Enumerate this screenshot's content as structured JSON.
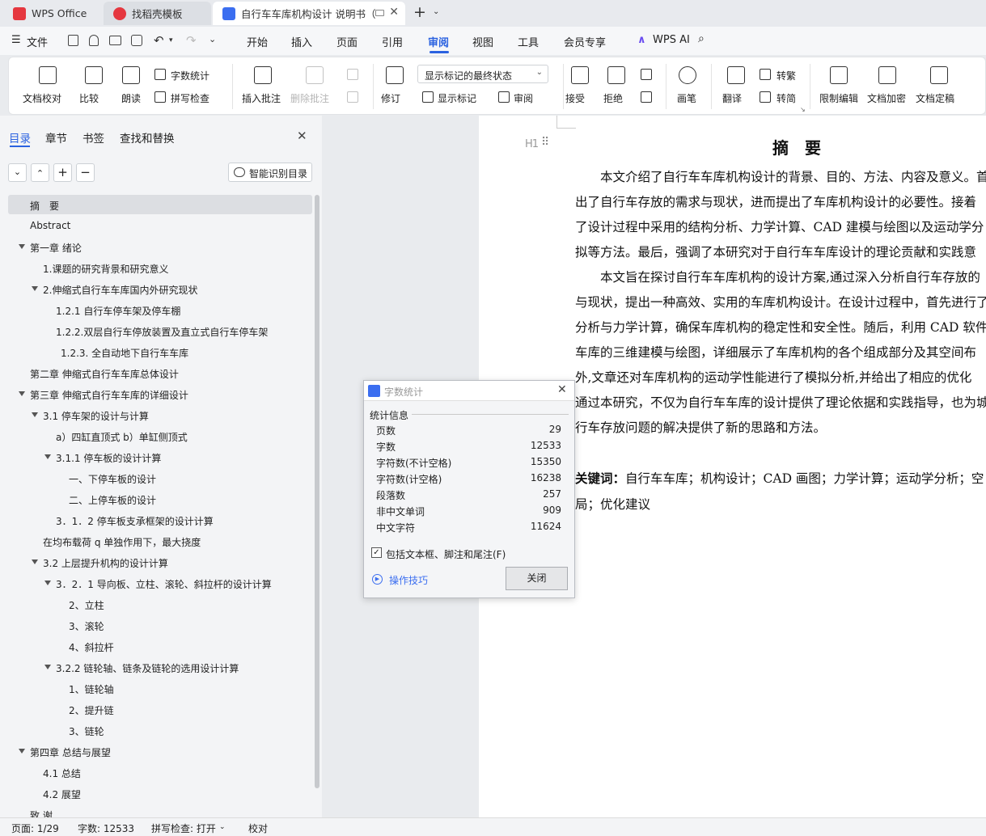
{
  "tabs": [
    {
      "label": "WPS Office"
    },
    {
      "label": "找稻壳模板"
    },
    {
      "label": "自行车车库机构设计 说明书（"
    }
  ],
  "menu": {
    "file": "文件",
    "items": [
      "开始",
      "插入",
      "页面",
      "引用",
      "审阅",
      "视图",
      "工具",
      "会员专享"
    ],
    "active": "审阅",
    "ai": "WPS AI"
  },
  "ribbon": {
    "doc_check": "文档校对",
    "compare": "比较",
    "read": "朗读",
    "word_count": "字数统计",
    "spell_check": "拼写检查",
    "insert_comment": "插入批注",
    "delete_comment": "删除批注",
    "revise": "修订",
    "show_state": "显示标记的最终状态",
    "show_markup": "显示标记",
    "review": "审阅",
    "accept": "接受",
    "reject": "拒绝",
    "pen": "画笔",
    "translate": "翻译",
    "to_traditional": "转繁",
    "to_simplified": "转简",
    "restrict_edit": "限制编辑",
    "encrypt": "文档加密",
    "finalize": "文档定稿"
  },
  "panel": {
    "tabs": [
      "目录",
      "章节",
      "书签",
      "查找和替换"
    ],
    "active_tab": "目录",
    "smart_button": "智能识别目录",
    "toc": [
      {
        "text": "摘　要",
        "level": 1,
        "selected": true
      },
      {
        "text": "Abstract",
        "level": 1
      },
      {
        "text": "第一章  绪论",
        "level": 1,
        "arrow": true
      },
      {
        "text": "1.课题的研究背景和研究意义",
        "level": 2
      },
      {
        "text": "2.伸缩式自行车车库国内外研究现状",
        "level": 2,
        "arrow": true
      },
      {
        "text": "1.2.1    自行车停车架及停车棚",
        "level": 3
      },
      {
        "text": "1.2.2.双层自行车停放装置及直立式自行车停车架",
        "level": 3
      },
      {
        "text": "1.2.3.  全自动地下自行车车库",
        "level": 3.4
      },
      {
        "text": "第二章  伸缩式自行车车库总体设计",
        "level": 1
      },
      {
        "text": "第三章  伸缩式自行车车库的详细设计",
        "level": 1,
        "arrow": true
      },
      {
        "text": "3.1    停车架的设计与计算",
        "level": 2,
        "arrow": true
      },
      {
        "text": "a）四缸直顶式    b）单缸侧顶式",
        "level": 3
      },
      {
        "text": "3.1.1    停车板的设计计算",
        "level": 3,
        "arrow": true
      },
      {
        "text": "一、下停车板的设计",
        "level": 4
      },
      {
        "text": "二、上停车板的设计",
        "level": 4
      },
      {
        "text": "3．1．2    停车板支承框架的设计计算",
        "level": 3
      },
      {
        "text": "在均布载荷 q 单独作用下，最大挠度",
        "level": 2
      },
      {
        "text": "3.2    上层提升机构的设计计算",
        "level": 2,
        "arrow": true
      },
      {
        "text": "3．2．1    导向板、立柱、滚轮、斜拉杆的设计计算",
        "level": 3,
        "arrow": true
      },
      {
        "text": "2、立柱",
        "level": 4
      },
      {
        "text": "3、滚轮",
        "level": 4
      },
      {
        "text": "4、斜拉杆",
        "level": 4
      },
      {
        "text": "3.2.2    链轮轴、链条及链轮的选用设计计算",
        "level": 3,
        "arrow": true
      },
      {
        "text": "1、链轮轴",
        "level": 4
      },
      {
        "text": "2、提升链",
        "level": 4
      },
      {
        "text": "3、链轮",
        "level": 4
      },
      {
        "text": "第四章  总结与展望",
        "level": 1,
        "arrow": true
      },
      {
        "text": "4.1  总结",
        "level": 2
      },
      {
        "text": "4.2  展望",
        "level": 2
      },
      {
        "text": "致    谢",
        "level": 1
      }
    ]
  },
  "document": {
    "heading_marker": "H1",
    "title": "摘　要",
    "lines": [
      "　　本文介绍了自行车车库机构设计的背景、目的、方法、内容及意义。首",
      "出了自行车存放的需求与现状，进而提出了车库机构设计的必要性。接着",
      "了设计过程中采用的结构分析、力学计算、CAD 建模与绘图以及运动学分",
      "拟等方法。最后，强调了本研究对于自行车车库设计的理论贡献和实践意",
      "　　本文旨在探讨自行车车库机构的设计方案,通过深入分析自行车存放的",
      "与现状，提出一种高效、实用的车库机构设计。在设计过程中，首先进行了",
      "分析与力学计算，确保车库机构的稳定性和安全性。随后，利用 CAD 软件",
      "车库的三维建模与绘图，详细展示了车库机构的各个组成部分及其空间布",
      "外,文章还对车库机构的运动学性能进行了模拟分析,并给出了相应的优化",
      "通过本研究，不仅为自行车车库的设计提供了理论依据和实践指导，也为城",
      "行车存放问题的解决提供了新的思路和方法。"
    ],
    "keywords_label": "关键词：",
    "keywords_line1": "自行车车库；机构设计；CAD 画图；力学计算；运动学分析；空",
    "keywords_line2": "局；优化建议"
  },
  "dialog": {
    "title": "字数统计",
    "section": "统计信息",
    "rows": [
      {
        "label": "页数",
        "value": "29"
      },
      {
        "label": "字数",
        "value": "12533"
      },
      {
        "label": "字符数(不计空格)",
        "value": "15350"
      },
      {
        "label": "字符数(计空格)",
        "value": "16238"
      },
      {
        "label": "段落数",
        "value": "257"
      },
      {
        "label": "非中文单词",
        "value": "909"
      },
      {
        "label": "中文字符",
        "value": "11624"
      }
    ],
    "checkbox": "包括文本框、脚注和尾注(F)",
    "checked": true,
    "tips": "操作技巧",
    "close": "关闭"
  },
  "status": {
    "page": "页面: 1/29",
    "words": "字数: 12533",
    "spell": "拼写检查: 打开",
    "proof": "校对"
  },
  "colors": {
    "accent": "#2b62e0",
    "wps_red": "#e5373f",
    "doc_blue": "#3b6ef0"
  }
}
